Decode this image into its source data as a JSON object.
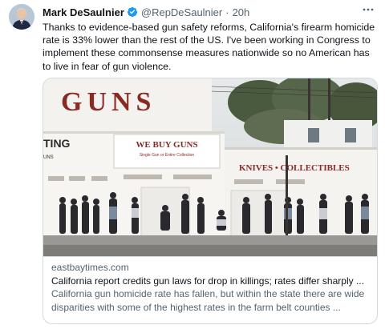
{
  "tweet": {
    "author_name": "Mark DeSaulnier",
    "handle": "@RepDeSaulnier",
    "separator": "·",
    "time": "20h",
    "text": "Thanks to evidence-based gun safety reforms, California's firearm homicide rate is 33% lower than the rest of the US. I've been working in Congress to implement these commonsense measures nationwide so no American has to live in fear of gun violence.",
    "more_icon": "more-horizontal-icon",
    "verified_icon": "verified-badge-icon"
  },
  "card": {
    "domain": "eastbaytimes.com",
    "title": "California report credits gun laws for drop in killings; rates differ sharply ...",
    "description": "California gun homicide rate has fallen, but within the state there are wide disparities with some of the highest rates in the farm belt counties ...",
    "photo": {
      "sign_guns": "GUNS",
      "sign_we_buy": "WE BUY GUNS",
      "sign_we_buy_sub": "Single Gun or Entire Collection",
      "sign_knives": "KNIVES • COLLECTIBLES",
      "sign_side_1": "TING",
      "sign_side_2": "UNS"
    }
  },
  "colors": {
    "verified": "#1d9bf0",
    "secondary_text": "#536471",
    "border": "#cfd9de",
    "sign_red": "#8a2a24"
  }
}
